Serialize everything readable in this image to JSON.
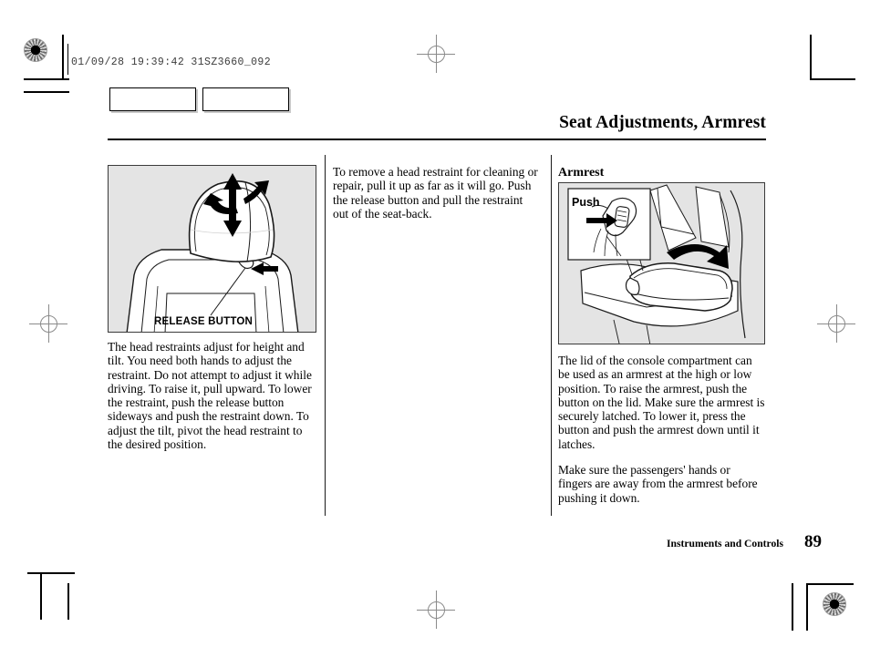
{
  "print_marks": {
    "slug": "01/09/28 19:39:42 31SZ3660_092",
    "rosette_name": "registration-rosette",
    "crosshair_name": "registration-crosshair"
  },
  "tag_boxes": [
    {
      "label": ""
    },
    {
      "label": ""
    }
  ],
  "header": {
    "title": "Seat Adjustments, Armrest"
  },
  "left_column": {
    "figure": {
      "caption": "RELEASE BUTTON",
      "alt": "Head restraint with up-down and tilt arrows, release button on seat-back"
    },
    "paragraphs": [
      "The head restraints adjust for height and tilt. You need both hands to adjust the restraint. Do not attempt to adjust it while driving. To raise it, pull upward. To lower the restraint, push the release button sideways and push the restraint down. To adjust the tilt, pivot the head restraint to the desired position."
    ]
  },
  "middle_column": {
    "paragraphs": [
      "To remove a head restraint for cleaning or repair, pull it up as far as it will go. Push the release button and pull the restraint out of the seat-back."
    ]
  },
  "right_column": {
    "heading": "Armrest",
    "figure": {
      "inset_label": "Push",
      "alt": "Console compartment lid used as armrest, inset shows pushing the release button"
    },
    "paragraphs": [
      "The lid of the console compartment can be used as an armrest at the high or low position. To raise the armrest, push the button on the lid. Make sure the armrest is securely latched. To lower it, press the button and push the armrest down until it latches.",
      "Make sure the passengers' hands or fingers are away from the armrest before pushing it down."
    ]
  },
  "footer": {
    "section": "Instruments and Controls",
    "page_number": "89"
  },
  "colors": {
    "figure_background": "#e4e4e4",
    "ink": "#000000",
    "rule": "#1a1a1a"
  }
}
